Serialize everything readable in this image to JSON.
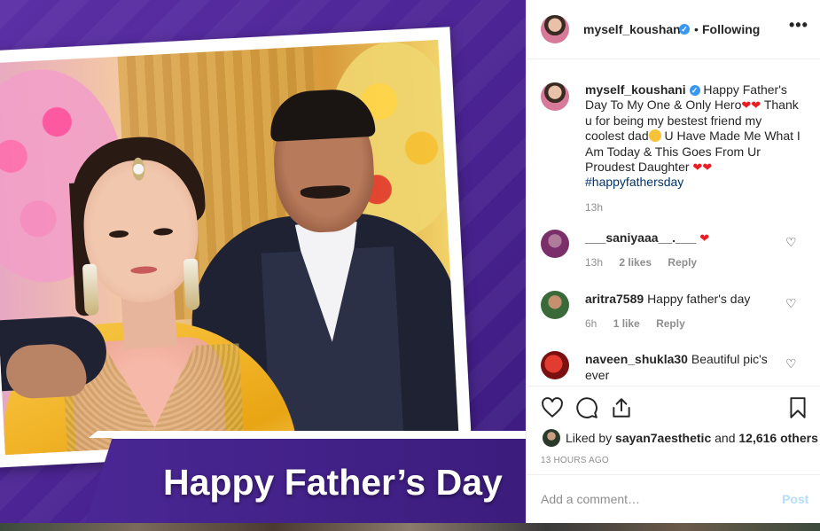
{
  "post": {
    "banner_text": "Happy Father’s Day"
  },
  "header": {
    "username": "myself_koushani",
    "dot": "•",
    "follow_status": "Following",
    "more": "•••"
  },
  "caption": {
    "username": "myself_koushani",
    "text_1": "Happy Father's Day To My One & Only Hero",
    "text_2": "Thank u for being my bestest friend my coolest dad",
    "text_3": "U Have Made Me What I Am Today & This Goes From Ur Proudest Daughter",
    "hashtag": "#happyfathersday",
    "time": "13h"
  },
  "comments": [
    {
      "username": "___saniyaaa__.___",
      "text": "",
      "time": "13h",
      "likes": "2 likes",
      "reply": "Reply"
    },
    {
      "username": "aritra7589",
      "text": "Happy father's day",
      "time": "6h",
      "likes": "1 like",
      "reply": "Reply"
    },
    {
      "username": "naveen_shukla30",
      "text": "Beautiful pic's ever"
    }
  ],
  "likes": {
    "prefix": "Liked by",
    "user": "sayan7aesthetic",
    "joiner": "and",
    "others": "12,616 others"
  },
  "time_ago": "13 HOURS AGO",
  "add_comment": {
    "placeholder": "Add a comment…",
    "post_label": "Post"
  },
  "icons": {
    "like": "heart-outline-icon",
    "comment": "comment-bubble-icon",
    "share": "share-upload-icon",
    "save": "bookmark-icon",
    "verified": "verified-badge-icon"
  },
  "colors": {
    "link_blue": "#003569",
    "verified_blue": "#3897f0",
    "heart_red": "#ed1c24",
    "muted_gray": "#8e8e8e",
    "post_disabled": "#b2dffc",
    "banner_purple": "#4a2794"
  }
}
